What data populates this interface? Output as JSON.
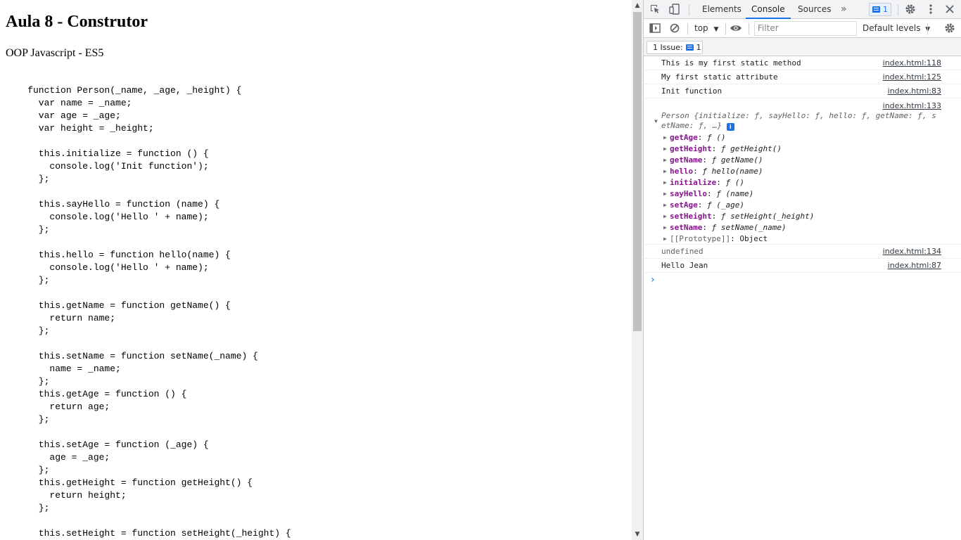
{
  "page": {
    "title": "Aula 8 - Construtor",
    "subtitle": "OOP Javascript - ES5",
    "code_lines": [
      "    function Person(_name, _age, _height) {",
      "      var name = _name;",
      "      var age = _age;",
      "      var height = _height;",
      "",
      "      this.initialize = function () {",
      "        console.log('Init function');",
      "      };",
      "",
      "      this.sayHello = function (name) {",
      "        console.log('Hello ' + name);",
      "      };",
      "",
      "      this.hello = function hello(name) {",
      "        console.log('Hello ' + name);",
      "      };",
      "",
      "      this.getName = function getName() {",
      "        return name;",
      "      };",
      "",
      "      this.setName = function setName(_name) {",
      "        name = _name;",
      "      };",
      "      this.getAge = function () {",
      "        return age;",
      "      };",
      "",
      "      this.setAge = function (_age) {",
      "        age = _age;",
      "      };",
      "      this.getHeight = function getHeight() {",
      "        return height;",
      "      };",
      "",
      "      this.setHeight = function setHeight(_height) {"
    ]
  },
  "devtools": {
    "tabs": [
      "Elements",
      "Console",
      "Sources"
    ],
    "active_tab": "Console",
    "more_tabs_glyph": "»",
    "messages_badge_count": "1",
    "context": "top",
    "filter_placeholder": "Filter",
    "levels": "Default levels",
    "issues_label": "1 Issue:",
    "issues_count": "1",
    "accent_color": "#1a73e8",
    "console": {
      "rows": [
        {
          "text": "This is my first static method",
          "source": "index.html:118"
        },
        {
          "text": "My first static attribute",
          "source": "index.html:125"
        },
        {
          "text": "Init function",
          "source": "index.html:83"
        }
      ],
      "object_source": "index.html:133",
      "object_preview_line1": "Person {initialize: ƒ, sayHello: ƒ, hello: ƒ, getName: ƒ, s",
      "object_preview_line2": "etName: ƒ, …}",
      "object_properties": [
        {
          "key": "getAge",
          "value": "ƒ ()"
        },
        {
          "key": "getHeight",
          "value": "ƒ getHeight()"
        },
        {
          "key": "getName",
          "value": "ƒ getName()"
        },
        {
          "key": "hello",
          "value": "ƒ hello(name)"
        },
        {
          "key": "initialize",
          "value": "ƒ ()"
        },
        {
          "key": "sayHello",
          "value": "ƒ (name)"
        },
        {
          "key": "setAge",
          "value": "ƒ (_age)"
        },
        {
          "key": "setHeight",
          "value": "ƒ setHeight(_height)"
        },
        {
          "key": "setName",
          "value": "ƒ setName(_name)"
        },
        {
          "key": "[[Prototype]]",
          "value": "Object"
        }
      ],
      "after_rows": [
        {
          "text": "undefined",
          "source": "index.html:134"
        },
        {
          "text": "Hello Jean",
          "source": "index.html:87"
        }
      ]
    }
  }
}
